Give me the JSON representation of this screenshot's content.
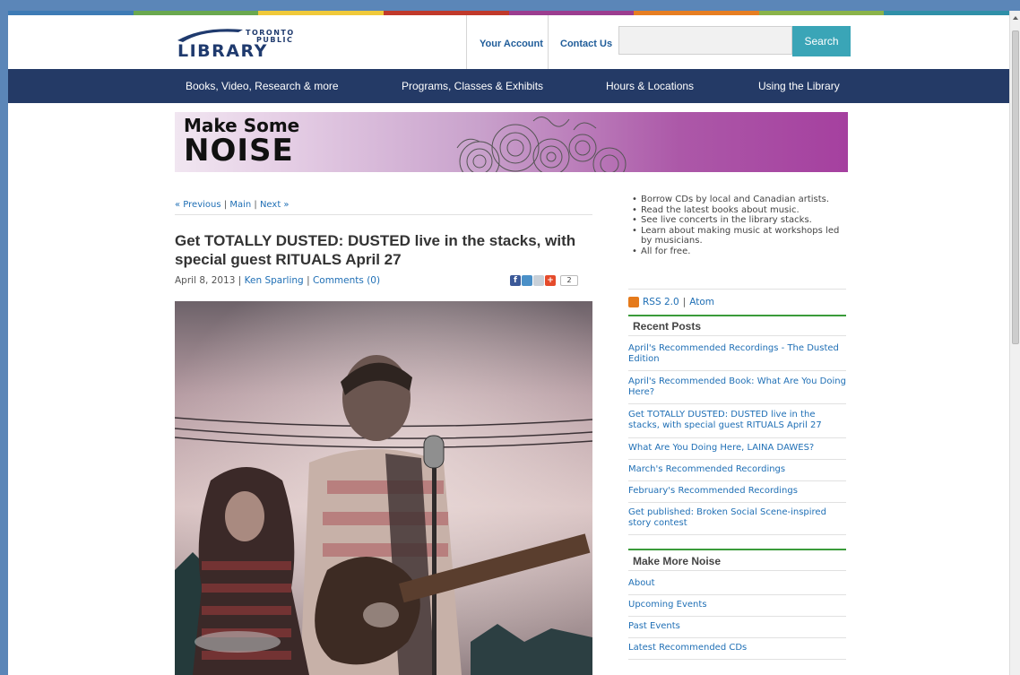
{
  "header": {
    "logo_top": "TORONTO",
    "logo_mid": "PUBLIC",
    "logo_main": "LIBRARY",
    "your_account": "Your Account",
    "contact_us": "Contact Us",
    "search_value": "",
    "search_button": "Search"
  },
  "nav": {
    "items": [
      {
        "label": "Books, Video, Research & more"
      },
      {
        "label": "Programs, Classes & Exhibits"
      },
      {
        "label": "Hours & Locations"
      },
      {
        "label": "Using the Library"
      }
    ]
  },
  "banner": {
    "line1": "Make Some",
    "line2": "NOISE"
  },
  "post": {
    "prev": "« Previous",
    "main": "Main",
    "next": "Next »",
    "sep": "|",
    "title": "Get TOTALLY DUSTED: DUSTED live in the stacks, with special guest RITUALS April 27",
    "date": "April 8, 2013",
    "author": "Ken Sparling",
    "comments": "Comments (0)",
    "share_count": "2"
  },
  "sidebar": {
    "bullets": [
      "Borrow CDs by local and Canadian artists.",
      "Read the latest books about music.",
      "See live concerts in the library stacks.",
      "Learn about making music at workshops led by musicians.",
      "All for free."
    ],
    "rss": "RSS 2.0",
    "atom": "Atom",
    "recent_posts_title": "Recent Posts",
    "recent_posts": [
      "April's Recommended Recordings - The Dusted Edition",
      "April's Recommended Book: What Are You Doing Here?",
      "Get TOTALLY DUSTED: DUSTED live in the stacks, with special guest RITUALS April 27",
      "What Are You Doing Here, LAINA DAWES?",
      "March's Recommended Recordings",
      "February's Recommended Recordings",
      "Get published: Broken Social Scene-inspired story contest"
    ],
    "more_noise_title": "Make More Noise",
    "more_noise": [
      "About",
      "Upcoming Events",
      "Past Events",
      "Latest Recommended CDs"
    ]
  },
  "colors": {
    "nav_bg": "#243a66",
    "link": "#1f6fb5",
    "search_btn": "#3aa5b7",
    "section_rule": "#3a9b3a",
    "banner_purple": "#a5409f"
  }
}
